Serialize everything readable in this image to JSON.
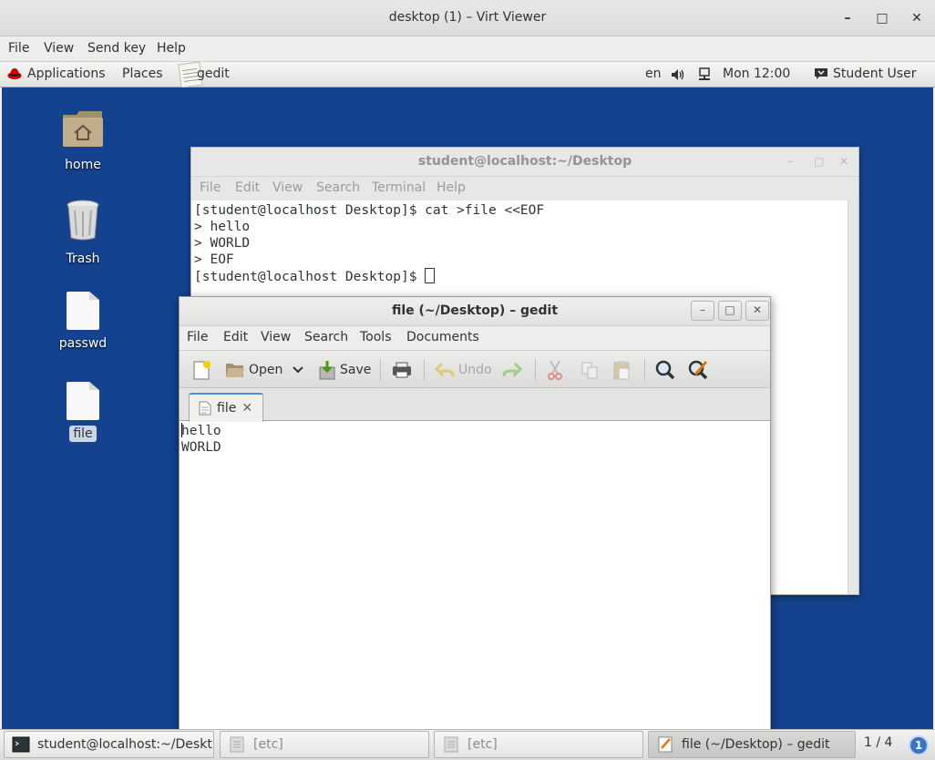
{
  "host": {
    "title": "desktop (1) – Virt Viewer",
    "menu": [
      "File",
      "View",
      "Send key",
      "Help"
    ],
    "controls": {
      "minimize": "–",
      "maximize": "□",
      "close": "✕"
    }
  },
  "topbar": {
    "applications": "Applications",
    "places": "Places",
    "active_app": "gedit",
    "lang": "en",
    "clock": "Mon 12:00",
    "user": "Student User"
  },
  "desktop_icons": [
    {
      "label": "home",
      "icon": "home-folder-icon"
    },
    {
      "label": "Trash",
      "icon": "trash-icon"
    },
    {
      "label": "passwd",
      "icon": "text-file-icon"
    },
    {
      "label": "file",
      "icon": "text-file-icon"
    }
  ],
  "terminal": {
    "title": "student@localhost:~/Desktop",
    "menu": [
      "File",
      "Edit",
      "View",
      "Search",
      "Terminal",
      "Help"
    ],
    "lines": [
      "[student@localhost Desktop]$ cat >file <<EOF",
      "> hello",
      "> WORLD",
      "> EOF"
    ],
    "prompt": "[student@localhost Desktop]$ "
  },
  "gedit": {
    "title": "file (~/Desktop) – gedit",
    "menu": [
      "File",
      "Edit",
      "View",
      "Search",
      "Tools",
      "Documents"
    ],
    "toolbar": {
      "open": "Open",
      "save": "Save",
      "undo": "Undo"
    },
    "tab": {
      "label": "file",
      "close": "✕"
    },
    "content": [
      "hello",
      "WORLD"
    ],
    "controls": {
      "minimize": "–",
      "maximize": "□",
      "close": "✕"
    }
  },
  "taskbar": {
    "items": [
      {
        "label": "student@localhost:~/Deskt...",
        "state": "normal"
      },
      {
        "label": "[etc]",
        "state": "dim"
      },
      {
        "label": "[etc]",
        "state": "dim"
      },
      {
        "label": "file (~/Desktop) – gedit",
        "state": "active"
      }
    ],
    "pager": "1 / 4",
    "pager_badge": "1"
  },
  "colors": {
    "desktop_bg": "#14428e",
    "tab_accent": "#4a90d9"
  }
}
